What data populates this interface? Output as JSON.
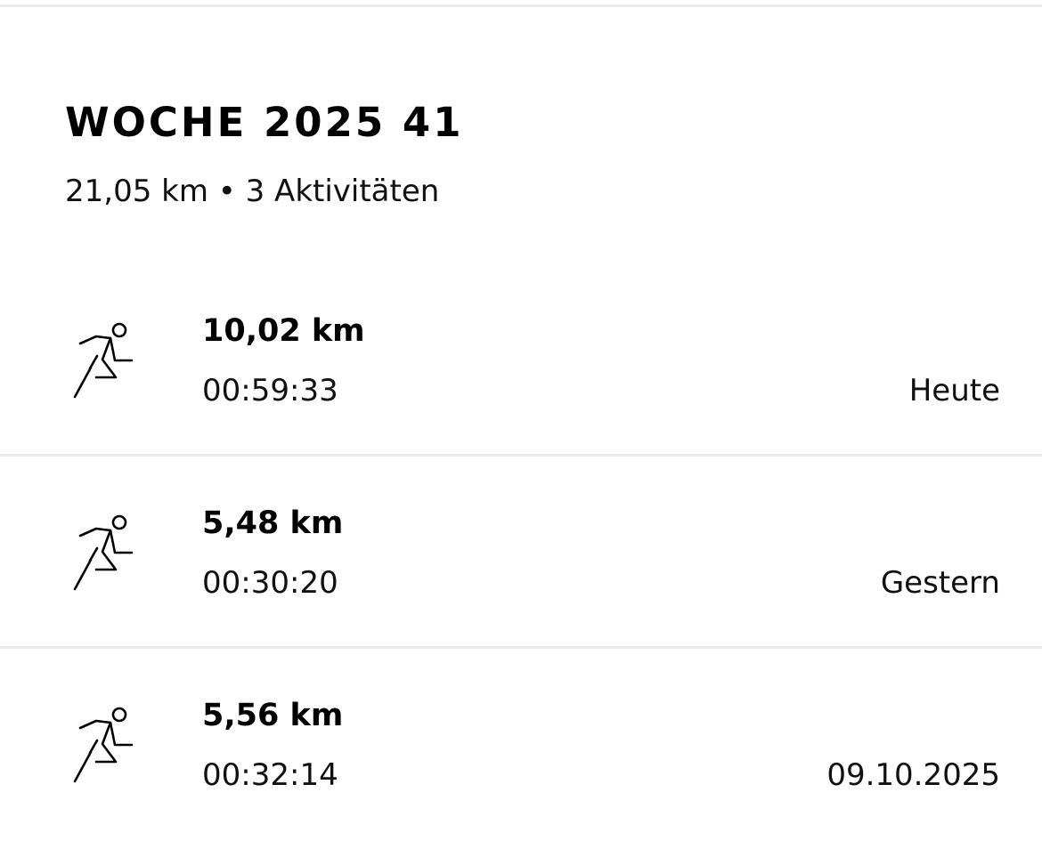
{
  "week": {
    "title": "WOCHE 2025 41",
    "summary": "21,05 km • 3 Aktivitäten"
  },
  "activities": [
    {
      "icon": "running-icon",
      "distance": "10,02 km",
      "duration": "00:59:33",
      "date": "Heute"
    },
    {
      "icon": "running-icon",
      "distance": "5,48 km",
      "duration": "00:30:20",
      "date": "Gestern"
    },
    {
      "icon": "running-icon",
      "distance": "5,56 km",
      "duration": "00:32:14",
      "date": "09.10.2025"
    }
  ],
  "colors": {
    "text": "#000000",
    "divider": "#e9e9e9",
    "background": "#ffffff"
  }
}
